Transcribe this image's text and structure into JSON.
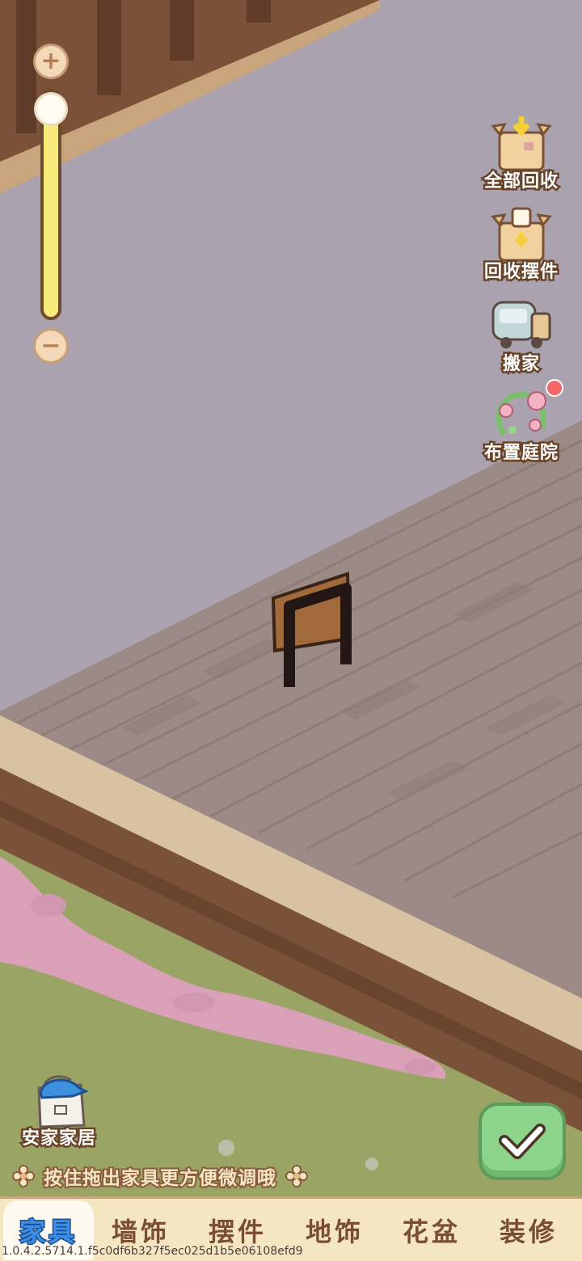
{
  "zoom": {
    "level": 0.95
  },
  "side_actions": [
    {
      "id": "recycle-all",
      "label": "全部回收",
      "icon": "box-download-icon"
    },
    {
      "id": "recycle-decor",
      "label": "回收摆件",
      "icon": "cup-box-icon"
    },
    {
      "id": "move-house",
      "label": "搬家",
      "icon": "truck-icon"
    },
    {
      "id": "arrange-yard",
      "label": "布置庭院",
      "icon": "flower-wreath-icon",
      "badge": true
    }
  ],
  "store": {
    "label": "安家家居",
    "icon": "bag-cap-icon"
  },
  "hint": {
    "text": "按住拖出家具更方便微调哦"
  },
  "tabs": [
    {
      "label": "家具",
      "active": true
    },
    {
      "label": "墙饰",
      "active": false
    },
    {
      "label": "摆件",
      "active": false
    },
    {
      "label": "地饰",
      "active": false
    },
    {
      "label": "花盆",
      "active": false
    },
    {
      "label": "装修",
      "active": false
    }
  ],
  "version": "1.0.4.2.5714.1.f5c0df6b327f5ec025d1b5e06108efd9",
  "colors": {
    "accent": "#3d8fe6",
    "confirm": "#8bd48a",
    "badge": "#f26868"
  }
}
